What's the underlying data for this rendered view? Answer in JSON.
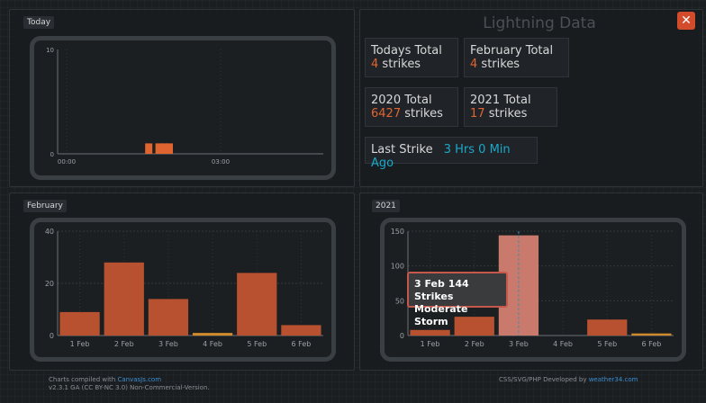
{
  "today_panel": {
    "label": "Today"
  },
  "lightning": {
    "title": "Lightning Data",
    "close_label": "✕",
    "todays_total": {
      "label": "Todays Total",
      "value": "4",
      "unit": "strikes"
    },
    "february_total": {
      "label": "February Total",
      "value": "4",
      "unit": "strikes"
    },
    "total_2020": {
      "label": "2020 Total",
      "value": "6427",
      "unit": "strikes"
    },
    "total_2021": {
      "label": "2021 Total",
      "value": "17",
      "unit": "strikes"
    },
    "last_strike": {
      "label": "Last Strike",
      "value": "3 Hrs 0 Min Ago"
    }
  },
  "february_panel": {
    "label": "February"
  },
  "year_panel": {
    "label": "2021"
  },
  "tooltip": {
    "line1": "3 Feb 144 Strikes",
    "line2": "Moderate Storm"
  },
  "footer": {
    "left_prefix": "Charts compiled with ",
    "left_link": "CanvasJs.com",
    "left_line2": "v2.3.1 GA (CC BY-NC 3.0) Non-Commercial-Version.",
    "right_prefix": "CSS/SVG/PHP Developed by ",
    "right_link": "weather34.com"
  },
  "colors": {
    "bar": "#b8512f",
    "bar_highlight": "#c97a6d",
    "bar_small": "#d08a2a",
    "accent": "#e0642f",
    "cyan": "#19a9c9",
    "close": "#d24b2a"
  },
  "chart_data": [
    {
      "type": "bar",
      "title": "Today",
      "xlabel": "",
      "ylabel": "",
      "ylim": [
        0,
        10
      ],
      "xtick_labels": [
        "00:00",
        "03:00"
      ],
      "ytick_labels": [
        "0",
        "10"
      ],
      "x": [
        "01:36",
        "01:48",
        "01:54",
        "02:00"
      ],
      "values": [
        1,
        1,
        1,
        1
      ],
      "xrange_hours": [
        0,
        5
      ]
    },
    {
      "type": "bar",
      "title": "February",
      "categories": [
        "1 Feb",
        "2 Feb",
        "3 Feb",
        "4 Feb",
        "5 Feb",
        "6 Feb"
      ],
      "values": [
        9,
        28,
        14,
        1,
        24,
        4
      ],
      "ylim": [
        0,
        40
      ],
      "ytick_labels": [
        "0",
        "20",
        "40"
      ],
      "xlabel": "",
      "ylabel": ""
    },
    {
      "type": "bar",
      "title": "2021",
      "categories": [
        "1 Feb",
        "2 Feb",
        "3 Feb",
        "4 Feb",
        "5 Feb",
        "6 Feb"
      ],
      "values": [
        8,
        27,
        144,
        0,
        23,
        3
      ],
      "highlight_index": 2,
      "ylim": [
        0,
        150
      ],
      "ytick_labels": [
        "0",
        "50",
        "100",
        "150"
      ],
      "xlabel": "",
      "ylabel": ""
    }
  ]
}
